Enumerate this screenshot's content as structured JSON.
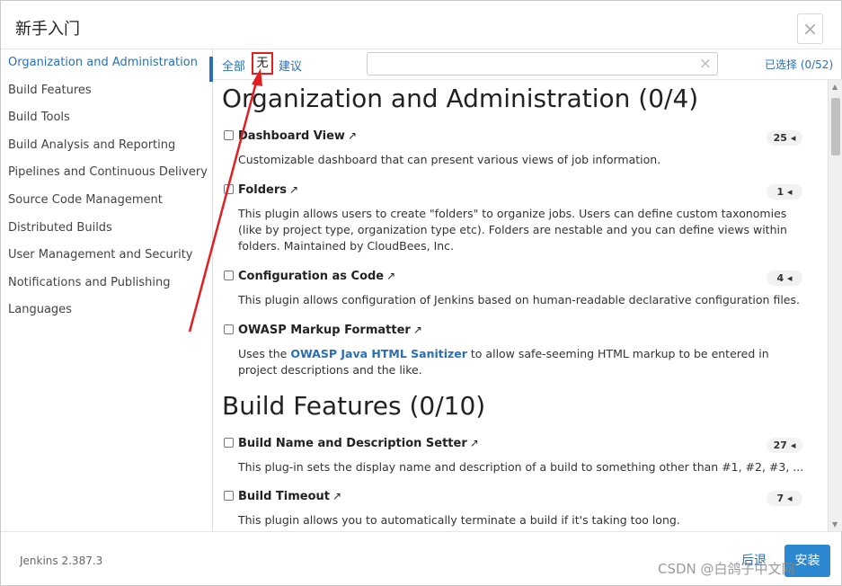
{
  "dialog": {
    "title": "新手入门",
    "close": "×"
  },
  "sidebar": {
    "items": [
      "Organization and Administration",
      "Build Features",
      "Build Tools",
      "Build Analysis and Reporting",
      "Pipelines and Continuous Delivery",
      "Source Code Management",
      "Distributed Builds",
      "User Management and Security",
      "Notifications and Publishing",
      "Languages"
    ],
    "active_index": 0
  },
  "toolbar": {
    "all": "全部",
    "none": "无",
    "suggested": "建议",
    "search_value": "",
    "search_clear": "×",
    "selected": "已选择 (0/52)"
  },
  "categories": [
    {
      "title": "Organization and Administration (0/4)",
      "plugins": [
        {
          "name": "Dashboard View",
          "count": "25",
          "desc": "Customizable dashboard that can present various views of job information."
        },
        {
          "name": "Folders",
          "count": "1",
          "desc": "This plugin allows users to create \"folders\" to organize jobs. Users can define custom taxonomies (like by project type, organization type etc). Folders are nestable and you can define views within folders. Maintained by CloudBees, Inc."
        },
        {
          "name": "Configuration as Code",
          "count": "4",
          "desc": "This plugin allows configuration of Jenkins based on human-readable declarative configuration files."
        },
        {
          "name": "OWASP Markup Formatter",
          "count": "",
          "desc_pre": "Uses the ",
          "desc_link": "OWASP Java HTML Sanitizer",
          "desc_post": " to allow safe-seeming HTML markup to be entered in project descriptions and the like."
        }
      ]
    },
    {
      "title": "Build Features (0/10)",
      "plugins": [
        {
          "name": "Build Name and Description Setter",
          "count": "27",
          "desc": "This plug-in sets the display name and description of a build to something other than #1, #2, #3, ..."
        },
        {
          "name": "Build Timeout",
          "count": "7",
          "desc": "This plugin allows you to automatically terminate a build if it's taking too long."
        }
      ]
    }
  ],
  "glyphs": {
    "external": "↗",
    "badge_arrow": "◂",
    "scroll_up": "▲",
    "scroll_down": "▼"
  },
  "footer": {
    "version": "Jenkins 2.387.3",
    "back": "后退",
    "install": "安装"
  },
  "watermark": "CSDN @白鸽子中文网",
  "colors": {
    "accent": "#2a6fb5",
    "annotation": "#e02020",
    "install_button": "#2a87d0"
  }
}
